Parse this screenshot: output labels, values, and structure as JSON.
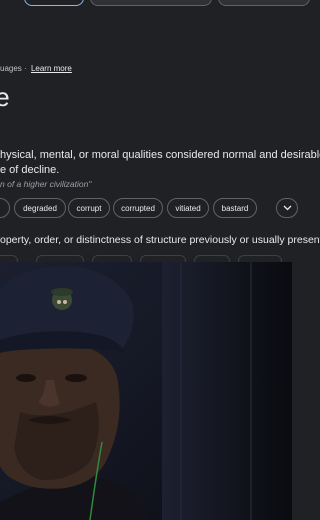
{
  "languages": {
    "prefix": "uages",
    "separator": "·",
    "learn_more": "Learn more"
  },
  "entry": {
    "word_fragment": "te"
  },
  "definition_1": {
    "line1": "hysical, mental, or moral qualities considered normal and desirable;",
    "line2": "e of decline.",
    "example": "n of a higher civilization\""
  },
  "synonyms": [
    "degraded",
    "corrupt",
    "corrupted",
    "vitiated",
    "bastard"
  ],
  "definition_2": {
    "text": "operty, order, or distinctness of structure previously or usually present."
  },
  "icons": {
    "expand": "chevron-down-icon"
  },
  "colors": {
    "background": "#202124",
    "text": "#e8eaed",
    "muted": "#9aa0a6",
    "chip_border": "#5f6368",
    "accent": "#8ab4f8"
  }
}
